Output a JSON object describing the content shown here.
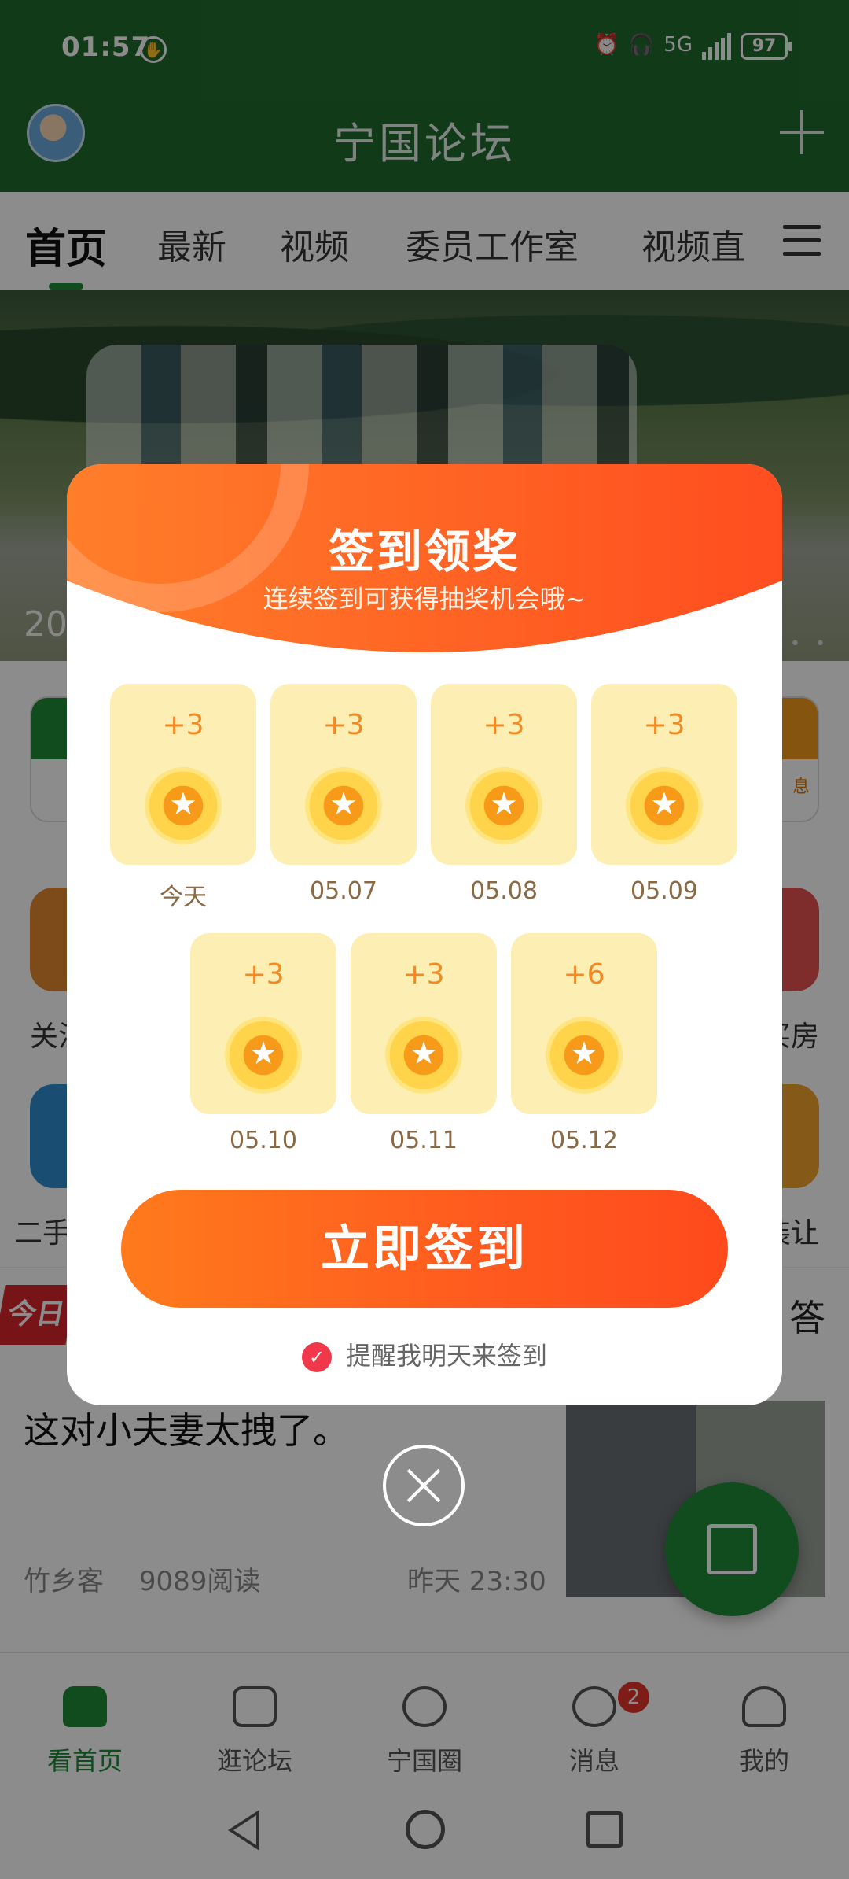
{
  "status_bar": {
    "time": "01:57",
    "battery": "97",
    "network": "5G"
  },
  "app": {
    "title": "宁国论坛"
  },
  "tabs": [
    "首页",
    "最新",
    "视频",
    "委员工作室",
    "视频直"
  ],
  "banner": {
    "year_fragment": "20"
  },
  "grid": {
    "right_card_hint": "息",
    "labels_left": [
      "关注",
      "二手"
    ],
    "labels_right": [
      "买房",
      "装让"
    ]
  },
  "today": {
    "logo": "今日",
    "right": "答"
  },
  "news": {
    "title": "这对小夫妻太拽了。",
    "author": "竹乡客",
    "reads": "9089阅读",
    "time": "昨天 23:30"
  },
  "bottom_nav": [
    {
      "label": "看首页",
      "icon": "home-icon",
      "active": true
    },
    {
      "label": "逛论坛",
      "icon": "chat-bubble-icon"
    },
    {
      "label": "宁国圈",
      "icon": "circle-icon"
    },
    {
      "label": "消息",
      "icon": "message-icon",
      "badge": "2"
    },
    {
      "label": "我的",
      "icon": "user-icon"
    }
  ],
  "dialog": {
    "title": "签到领奖",
    "subtitle": "连续签到可获得抽奖机会哦~",
    "days": [
      {
        "points": "+3",
        "label": "今天"
      },
      {
        "points": "+3",
        "label": "05.07"
      },
      {
        "points": "+3",
        "label": "05.08"
      },
      {
        "points": "+3",
        "label": "05.09"
      },
      {
        "points": "+3",
        "label": "05.10"
      },
      {
        "points": "+3",
        "label": "05.11"
      },
      {
        "points": "+6",
        "label": "05.12"
      }
    ],
    "button": "立即签到",
    "remind": "提醒我明天来签到"
  },
  "colors": {
    "brand_green": "#1f6b2e",
    "accent_orange": "#ff5a1f",
    "card_yellow": "#fdefb3"
  }
}
